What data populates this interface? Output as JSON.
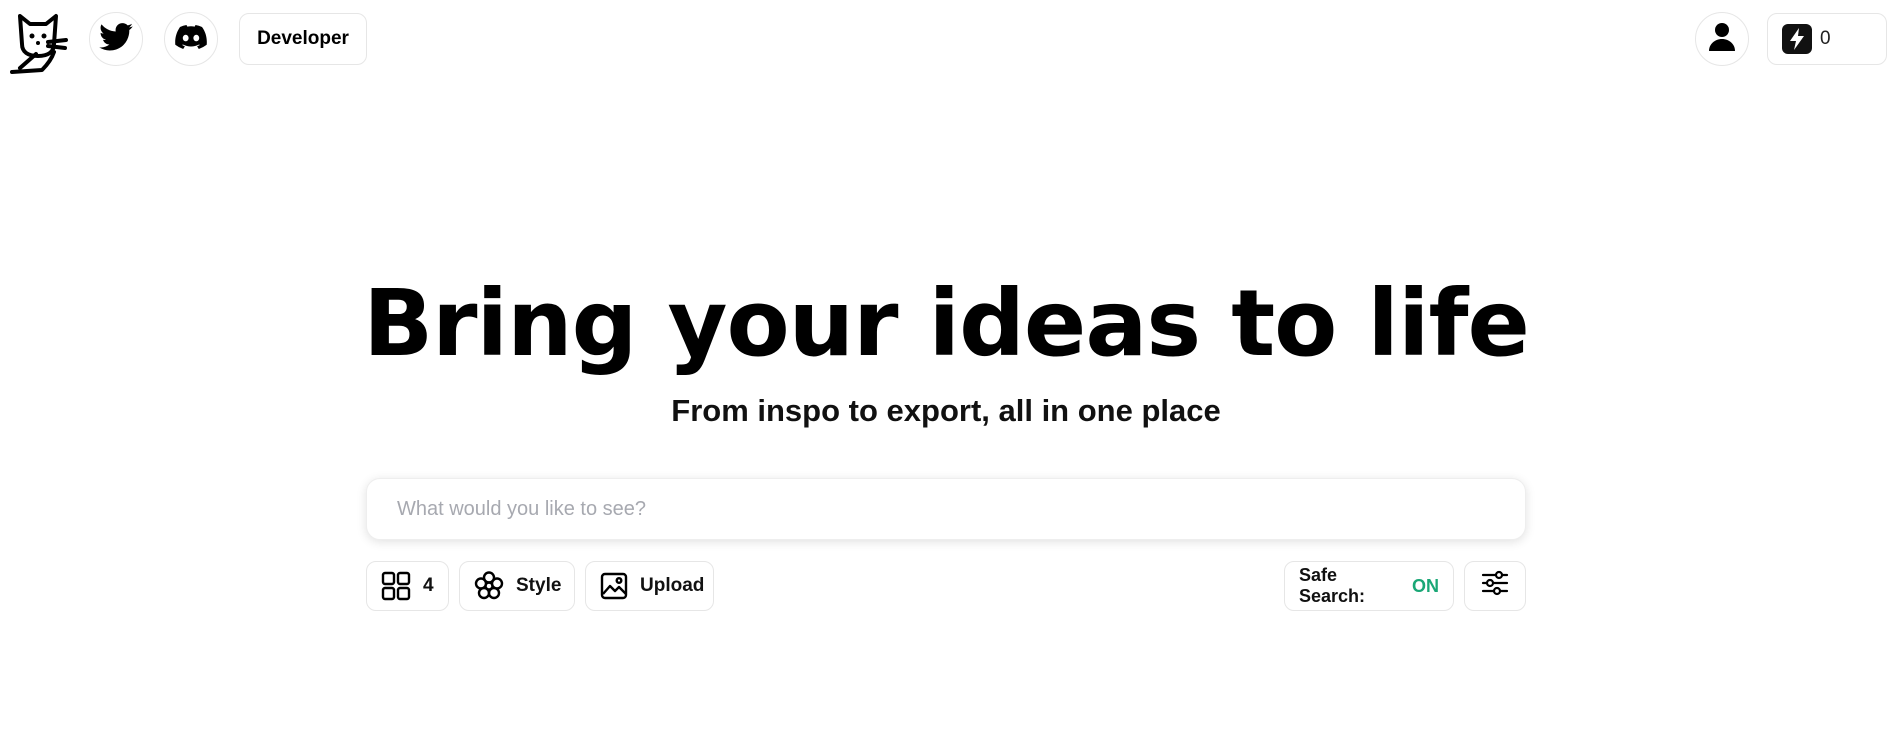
{
  "header": {
    "developer_label": "Developer",
    "credits_count": "0",
    "icons": [
      "cat-logo-icon",
      "twitter-icon",
      "discord-icon",
      "user-icon",
      "bolt-icon"
    ]
  },
  "hero": {
    "title": "Bring your ideas to life",
    "subtitle": "From inspo to export, all in one place"
  },
  "search": {
    "placeholder": "What would you like to see?",
    "value": ""
  },
  "toolbar": {
    "image_count": "4",
    "style_label": "Style",
    "upload_label": "Upload",
    "safe_search_label": "Safe Search:",
    "safe_search_value": "ON",
    "safe_search_color": "#1aa776",
    "icons": [
      "grid-icon",
      "flower-icon",
      "image-icon",
      "sliders-icon"
    ]
  }
}
